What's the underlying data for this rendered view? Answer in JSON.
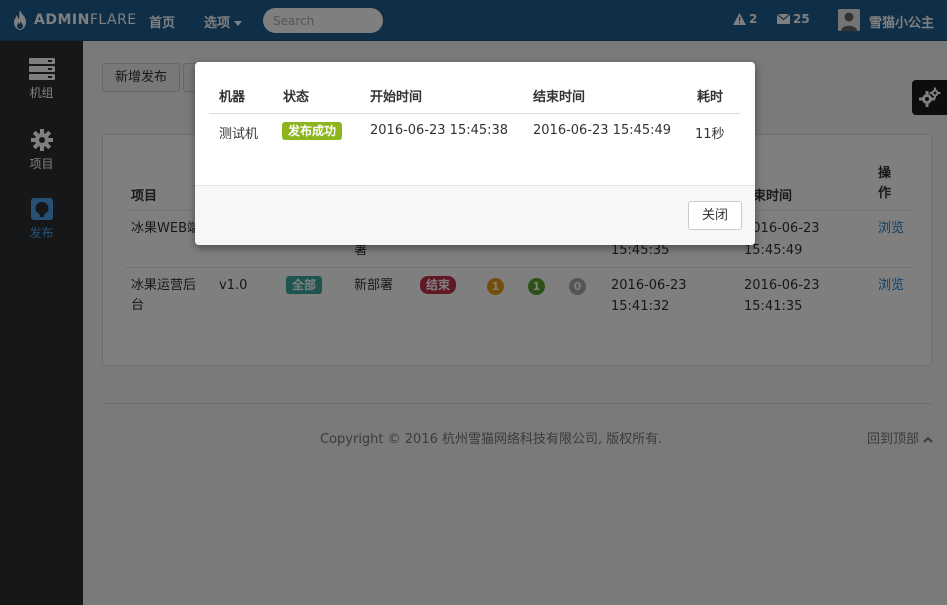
{
  "header": {
    "brand_bold": "ADMIN",
    "brand_light": "FLARE",
    "nav_home": "首页",
    "nav_options": "选项",
    "search_placeholder": "Search",
    "alerts_count": "2",
    "messages_count": "25",
    "username": "雪猫小公主"
  },
  "sidebar": {
    "items": [
      {
        "label": "机组",
        "icon": "server-icon"
      },
      {
        "label": "项目",
        "icon": "gear-icon"
      },
      {
        "label": "发布",
        "icon": "github-icon",
        "active": true
      }
    ]
  },
  "toolbar": {
    "new_release": "新增发布"
  },
  "table": {
    "headers": [
      "项目",
      "束时间",
      "操作"
    ],
    "rows": [
      {
        "project": "冰果WEB端",
        "deploy_type_tail": "署",
        "start_time": "15:45:35",
        "end_time_date": "2016-06-23",
        "end_time_clock": "15:45:49",
        "action": "浏览"
      },
      {
        "project": "冰果运营后台",
        "version": "v1.0",
        "scope": "全部",
        "deploy_type": "新部署",
        "status": "结束",
        "count_a": "1",
        "count_b": "1",
        "count_c": "0",
        "start_time_date": "2016-06-23",
        "start_time_clock": "15:41:32",
        "end_time_date": "2016-06-23",
        "end_time_clock": "15:41:35",
        "action": "浏览"
      }
    ]
  },
  "footer": {
    "copyright": "Copyright © 2016 杭州雪猫网络科技有限公司, 版权所有.",
    "back_to_top": "回到顶部"
  },
  "modal": {
    "headers": [
      "机器",
      "状态",
      "开始时间",
      "结束时间",
      "耗时"
    ],
    "row": {
      "machine": "测试机",
      "status": "发布成功",
      "start": "2016-06-23 15:45:38",
      "end": "2016-06-23 15:45:49",
      "duration": "11秒"
    },
    "close_label": "关闭"
  },
  "colors": {
    "topbar": "#1f5f92",
    "sidebar": "#2b2f33",
    "success": "#8cb51f",
    "scope": "#3aa8a0",
    "danger": "#c0304a",
    "warning": "#e89d16",
    "green": "#5aa02c",
    "gray": "#aaaaaa",
    "link": "#2a7ec1"
  }
}
